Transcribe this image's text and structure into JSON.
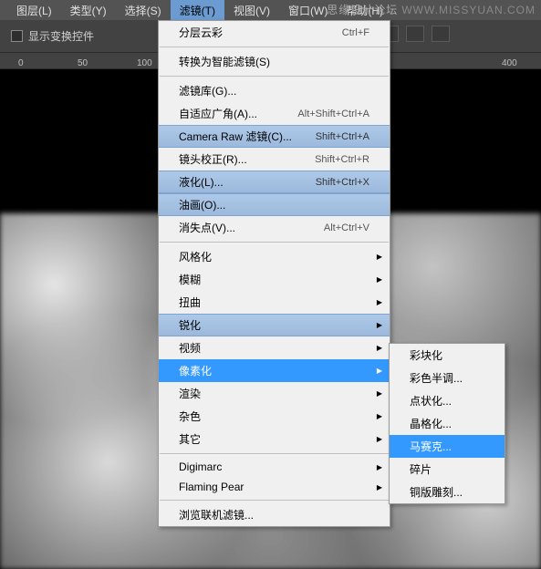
{
  "menubar": {
    "items": [
      "图层(L)",
      "类型(Y)",
      "选择(S)",
      "滤镜(T)",
      "视图(V)",
      "窗口(W)",
      "帮助(H)"
    ],
    "activeIndex": 3
  },
  "toolbar": {
    "checkbox_label": "显示变换控件"
  },
  "ruler": {
    "ticks": [
      {
        "val": "0",
        "pos": 20
      },
      {
        "val": "50",
        "pos": 85
      },
      {
        "val": "100",
        "pos": 150
      },
      {
        "val": "400",
        "pos": 550
      }
    ]
  },
  "dropdown": {
    "groups": [
      [
        {
          "label": "分层云彩",
          "shortcut": "Ctrl+F"
        }
      ],
      [
        {
          "label": "转换为智能滤镜(S)"
        }
      ],
      [
        {
          "label": "滤镜库(G)..."
        },
        {
          "label": "自适应广角(A)...",
          "shortcut": "Alt+Shift+Ctrl+A"
        },
        {
          "label": "Camera Raw 滤镜(C)...",
          "shortcut": "Shift+Ctrl+A",
          "highlighted": true
        },
        {
          "label": "镜头校正(R)...",
          "shortcut": "Shift+Ctrl+R"
        },
        {
          "label": "液化(L)...",
          "shortcut": "Shift+Ctrl+X",
          "highlighted": true
        },
        {
          "label": "油画(O)...",
          "highlighted": true
        },
        {
          "label": "消失点(V)...",
          "shortcut": "Alt+Ctrl+V"
        }
      ],
      [
        {
          "label": "风格化",
          "submenu": true
        },
        {
          "label": "模糊",
          "submenu": true
        },
        {
          "label": "扭曲",
          "submenu": true
        },
        {
          "label": "锐化",
          "submenu": true,
          "highlighted": true
        },
        {
          "label": "视频",
          "submenu": true
        },
        {
          "label": "像素化",
          "submenu": true,
          "selected": true
        },
        {
          "label": "渲染",
          "submenu": true
        },
        {
          "label": "杂色",
          "submenu": true
        },
        {
          "label": "其它",
          "submenu": true
        }
      ],
      [
        {
          "label": "Digimarc",
          "submenu": true
        },
        {
          "label": "Flaming Pear",
          "submenu": true
        }
      ],
      [
        {
          "label": "浏览联机滤镜..."
        }
      ]
    ]
  },
  "submenu": {
    "items": [
      {
        "label": "彩块化"
      },
      {
        "label": "彩色半调..."
      },
      {
        "label": "点状化..."
      },
      {
        "label": "晶格化..."
      },
      {
        "label": "马赛克...",
        "selected": true
      },
      {
        "label": "碎片"
      },
      {
        "label": "铜版雕刻..."
      }
    ]
  },
  "watermark": {
    "cn": "思缘设计论坛",
    "en": "WWW.MISSYUAN.COM"
  }
}
